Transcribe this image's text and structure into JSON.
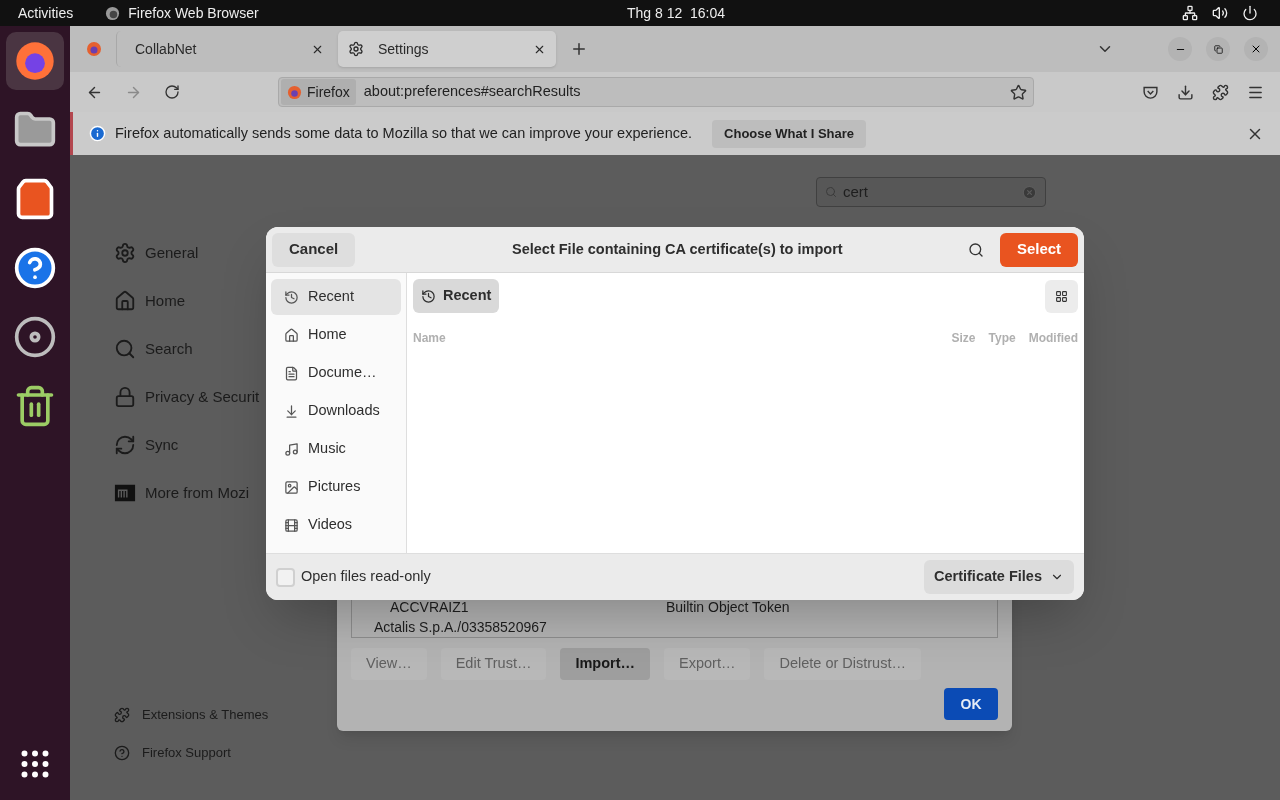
{
  "top_bar": {
    "activities": "Activities",
    "app_name": "Firefox Web Browser",
    "clock": "Thg 8 12  16:04"
  },
  "dock": [
    {
      "selected": true
    },
    {
      "selected": false
    },
    {
      "selected": false
    },
    {
      "selected": false
    },
    {
      "selected": false
    },
    {
      "selected": false
    }
  ],
  "tabs": [
    {
      "label": "CollabNet",
      "selected": false
    },
    {
      "label": "Settings",
      "selected": true
    }
  ],
  "address_bar": {
    "identity": "Firefox",
    "url": "about:preferences#searchResults"
  },
  "notification": {
    "text": "Firefox automatically sends some data to Mozilla so that we can improve your experience.",
    "button": "Choose What I Share"
  },
  "settings": {
    "search": "cert",
    "nav": [
      {
        "label": "General"
      },
      {
        "label": "Home"
      },
      {
        "label": "Search"
      },
      {
        "label": "Privacy & Securit"
      },
      {
        "label": "Sync"
      },
      {
        "label": "More from Mozi"
      }
    ],
    "footer_links": [
      "Extensions & Themes",
      "Firefox Support"
    ]
  },
  "certificate_manager": {
    "rows": [
      {
        "name": "ACCVRAIZ1",
        "token": "Builtin Object Token"
      },
      {
        "name": "Actalis S.p.A./03358520967",
        "token": ""
      }
    ],
    "buttons": [
      {
        "label": "View…",
        "disabled": true
      },
      {
        "label": "Edit Trust…",
        "disabled": true
      },
      {
        "label": "Import…",
        "disabled": false
      },
      {
        "label": "Export…",
        "disabled": true
      },
      {
        "label": "Delete or Distrust…",
        "disabled": true
      }
    ],
    "ok": "OK"
  },
  "file_dialog": {
    "cancel": "Cancel",
    "title": "Select File containing CA certificate(s) to import",
    "select": "Select",
    "places": [
      {
        "label": "Recent",
        "selected": true
      },
      {
        "label": "Home",
        "selected": false
      },
      {
        "label": "Docume…",
        "selected": false
      },
      {
        "label": "Downloads",
        "selected": false
      },
      {
        "label": "Music",
        "selected": false
      },
      {
        "label": "Pictures",
        "selected": false
      },
      {
        "label": "Videos",
        "selected": false
      }
    ],
    "path_button": "Recent",
    "columns": [
      "Name",
      "Size",
      "Type",
      "Modified"
    ],
    "read_only": {
      "label": "Open files read-only",
      "checked": false
    },
    "filter": "Certificate Files"
  }
}
